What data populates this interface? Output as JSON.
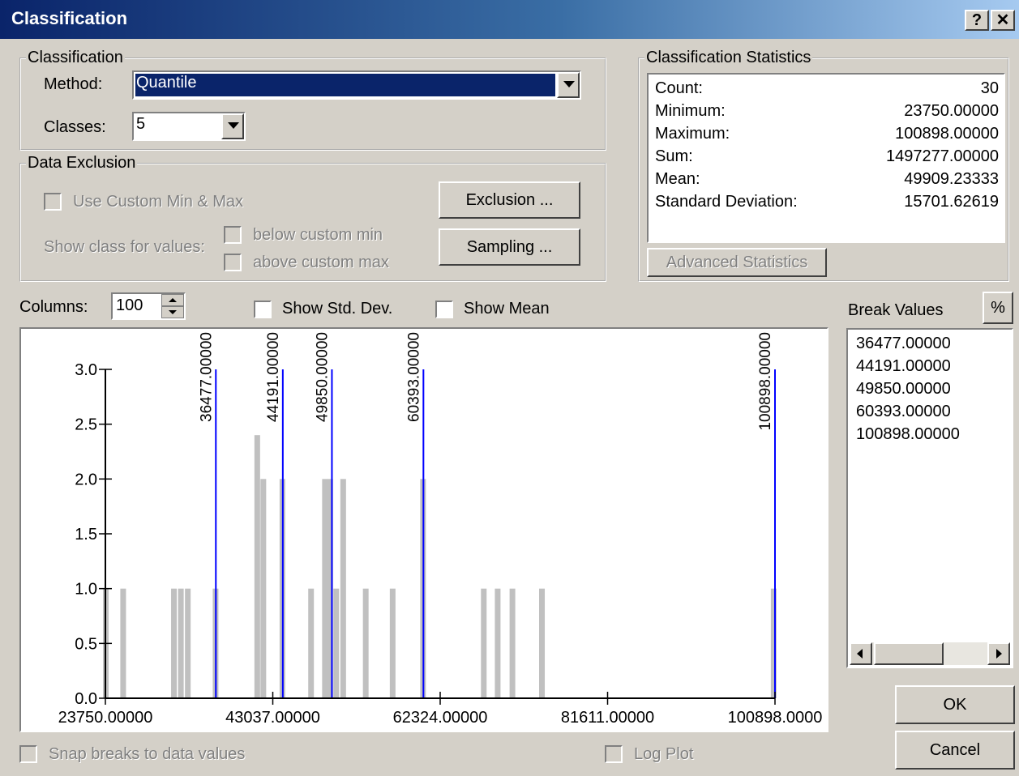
{
  "window": {
    "title": "Classification",
    "help_label": "?",
    "close_label": "✕"
  },
  "classification": {
    "group_label": "Classification",
    "method_label": "Method:",
    "method_value": "Quantile",
    "classes_label": "Classes:",
    "classes_value": "5"
  },
  "data_exclusion": {
    "group_label": "Data Exclusion",
    "custom_minmax_label": "Use Custom Min & Max",
    "show_class_label": "Show class for values:",
    "below_min_label": "below custom min",
    "above_max_label": "above custom max",
    "exclusion_button": "Exclusion ...",
    "sampling_button": "Sampling ..."
  },
  "statistics": {
    "group_label": "Classification Statistics",
    "rows": [
      {
        "label": "Count:",
        "value": "30"
      },
      {
        "label": "Minimum:",
        "value": "23750.00000"
      },
      {
        "label": "Maximum:",
        "value": "100898.00000"
      },
      {
        "label": "Sum:",
        "value": "1497277.00000"
      },
      {
        "label": "Mean:",
        "value": "49909.23333"
      },
      {
        "label": "Standard Deviation:",
        "value": "15701.62619"
      }
    ],
    "advanced_button": "Advanced Statistics"
  },
  "columns": {
    "label": "Columns:",
    "value": "100"
  },
  "show_std_dev_label": "Show Std. Dev.",
  "show_mean_label": "Show Mean",
  "break_values": {
    "label": "Break Values",
    "percent_button": "%",
    "values": [
      "36477.00000",
      "44191.00000",
      "49850.00000",
      "60393.00000",
      "100898.00000"
    ]
  },
  "snap_breaks_label": "Snap breaks to data values",
  "log_plot_label": "Log Plot",
  "ok_button": "OK",
  "cancel_button": "Cancel",
  "colors": {
    "title_start": "#0a246a",
    "title_end": "#a6caf0",
    "bar": "#c0c0c0",
    "break_line": "#0000ff",
    "selection": "#0a246a"
  },
  "chart_data": {
    "type": "bar",
    "xlim": [
      23750,
      100898
    ],
    "ylim": [
      0,
      3
    ],
    "x_ticks": [
      "23750.00000",
      "43037.00000",
      "62324.00000",
      "81611.00000",
      "100898.0000"
    ],
    "y_ticks": [
      "0.0",
      "0.5",
      "1.0",
      "1.5",
      "2.0",
      "2.5",
      "3.0"
    ],
    "bars": [
      {
        "x": 23750,
        "y": 1
      },
      {
        "x": 25750,
        "y": 1
      },
      {
        "x": 31600,
        "y": 1
      },
      {
        "x": 32400,
        "y": 1
      },
      {
        "x": 33200,
        "y": 1
      },
      {
        "x": 36400,
        "y": 1
      },
      {
        "x": 41200,
        "y": 2.4
      },
      {
        "x": 41900,
        "y": 2
      },
      {
        "x": 44100,
        "y": 2
      },
      {
        "x": 47400,
        "y": 1
      },
      {
        "x": 49000,
        "y": 2
      },
      {
        "x": 49600,
        "y": 2
      },
      {
        "x": 50300,
        "y": 1
      },
      {
        "x": 51100,
        "y": 2
      },
      {
        "x": 53700,
        "y": 1
      },
      {
        "x": 56800,
        "y": 1
      },
      {
        "x": 60300,
        "y": 2
      },
      {
        "x": 67300,
        "y": 1
      },
      {
        "x": 68900,
        "y": 1
      },
      {
        "x": 70600,
        "y": 1
      },
      {
        "x": 74000,
        "y": 1
      },
      {
        "x": 100700,
        "y": 1
      }
    ],
    "breaks": [
      {
        "value": 36477,
        "label": "36477.00000"
      },
      {
        "value": 44191,
        "label": "44191.00000"
      },
      {
        "value": 49850,
        "label": "49850.00000"
      },
      {
        "value": 60393,
        "label": "60393.00000"
      },
      {
        "value": 100898,
        "label": "100898.00000"
      }
    ]
  }
}
